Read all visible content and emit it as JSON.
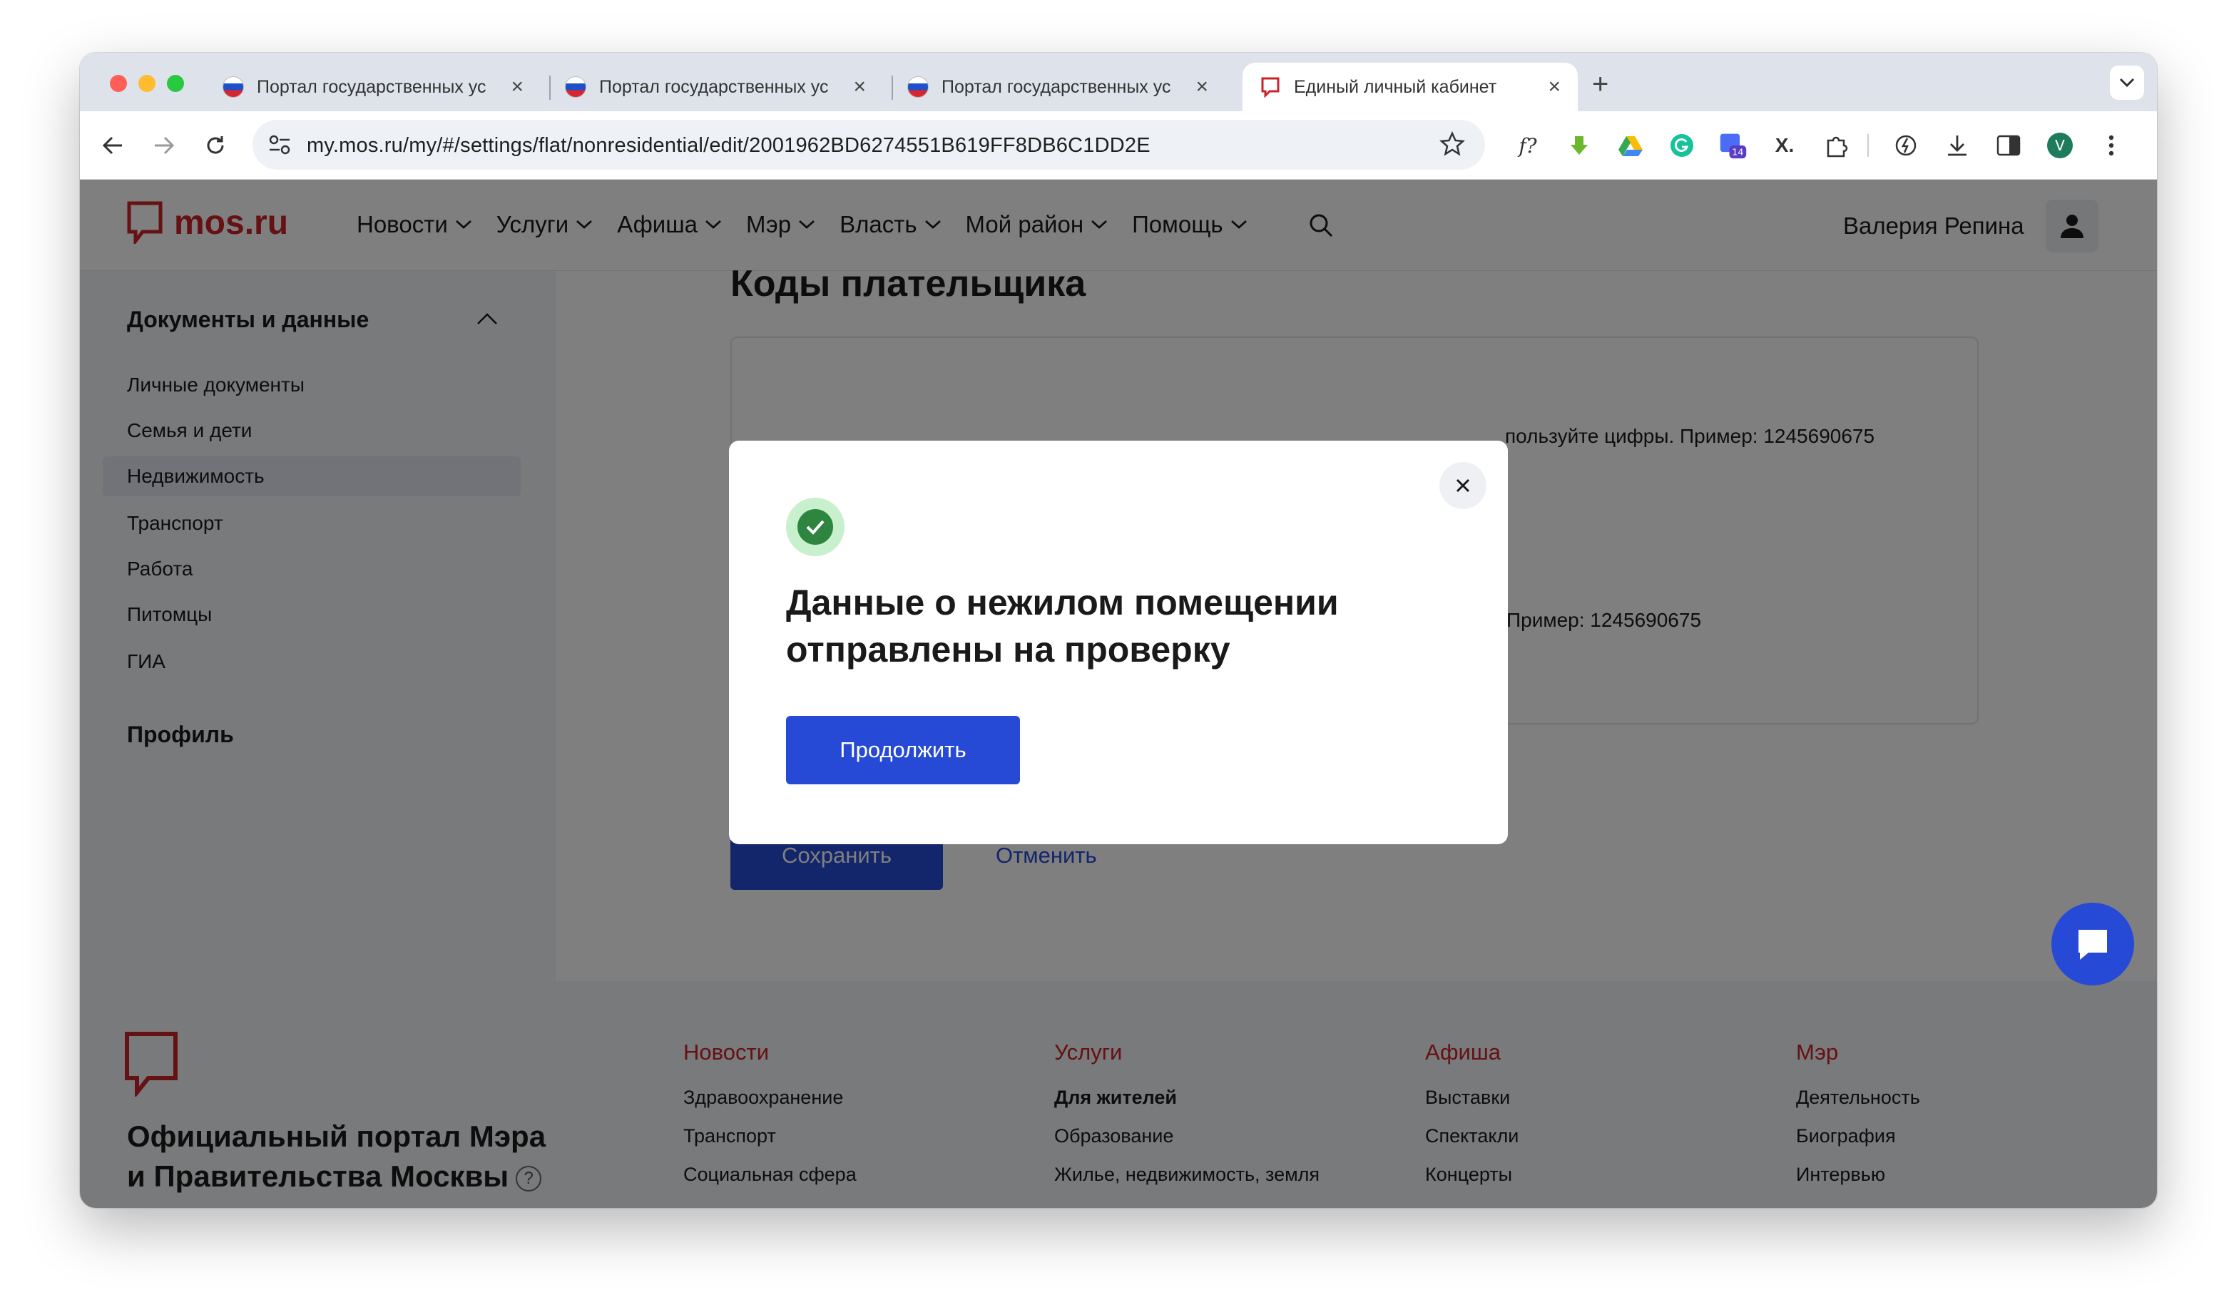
{
  "browser": {
    "tabs": [
      {
        "label": "Портал государственных ус"
      },
      {
        "label": "Портал государственных ус"
      },
      {
        "label": "Портал государственных ус"
      },
      {
        "label": "Единый личный кабинет"
      }
    ],
    "url": "my.mos.ru/my/#/settings/flat/nonresidential/edit/2001962BD6274551B619FF8DB6C1DD2E",
    "extension_badge": "14",
    "profile_initial": "V"
  },
  "header": {
    "logo_text": "mos.ru",
    "nav": [
      "Новости",
      "Услуги",
      "Афиша",
      "Мэр",
      "Власть",
      "Мой район",
      "Помощь"
    ],
    "user_name": "Валерия Репина"
  },
  "sidebar": {
    "section_title": "Документы и данные",
    "items": [
      "Личные документы",
      "Семья и дети",
      "Недвижимость",
      "Транспорт",
      "Работа",
      "Питомцы",
      "ГИА"
    ],
    "profile": "Профиль"
  },
  "content": {
    "title": "Коды плательщика",
    "hint_1": "пользуйте цифры. Пример: 1245690675",
    "hint_2": "Пример: 1245690675",
    "save_label": "Сохранить",
    "cancel_label": "Отменить"
  },
  "footer": {
    "title_line1": "Официальный портал Мэра",
    "title_line2": "и Правительства Москвы",
    "help": "?",
    "columns": [
      {
        "head": "Новости",
        "links": [
          "Здравоохранение",
          "Транспорт",
          "Социальная сфера"
        ]
      },
      {
        "head": "Услуги",
        "links": [
          "Для жителей",
          "Образование",
          "Жилье, недвижимость, земля"
        ]
      },
      {
        "head": "Афиша",
        "links": [
          "Выставки",
          "Спектакли",
          "Концерты"
        ]
      },
      {
        "head": "Мэр",
        "links": [
          "Деятельность",
          "Биография",
          "Интервью"
        ]
      }
    ]
  },
  "modal": {
    "title_line1": "Данные о нежилом помещении",
    "title_line2": "отправлены на проверку",
    "continue_label": "Продолжить",
    "close": "×"
  },
  "colors": {
    "brand_red": "#cc2229",
    "accent_blue": "#264ad6",
    "success_green": "#2e8540"
  }
}
